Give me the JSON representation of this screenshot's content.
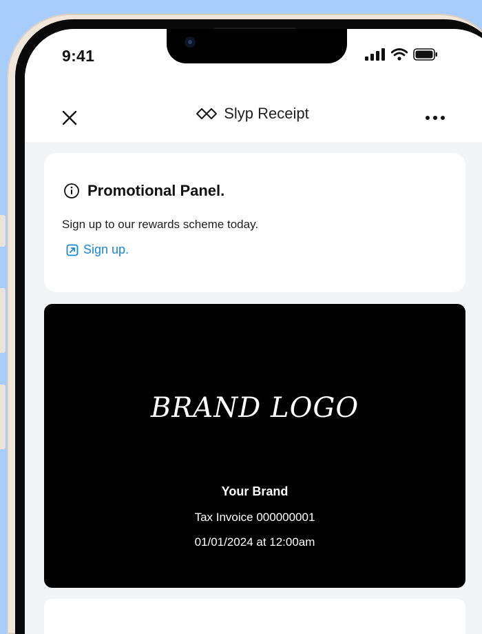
{
  "status_bar": {
    "time": "9:41"
  },
  "nav": {
    "title": "Slyp Receipt",
    "close_icon": "close-icon",
    "more_icon": "more-horizontal-icon",
    "logo_icon": "slyp-logo-icon"
  },
  "promo": {
    "title": "Promotional Panel.",
    "description": "Sign up to our rewards scheme today.",
    "link_label": "Sign up.",
    "link_icon": "external-link-icon",
    "info_icon": "info-icon"
  },
  "receipt": {
    "brand_logo": "BRAND LOGO",
    "brand_name": "Your Brand",
    "invoice": "Tax Invoice 000000001",
    "datetime": "01/01/2024 at 12:00am"
  },
  "colors": {
    "background": "#a9cdfb",
    "link": "#1687d6",
    "receipt_header": "#000000",
    "screen": "#f3f4f6"
  }
}
